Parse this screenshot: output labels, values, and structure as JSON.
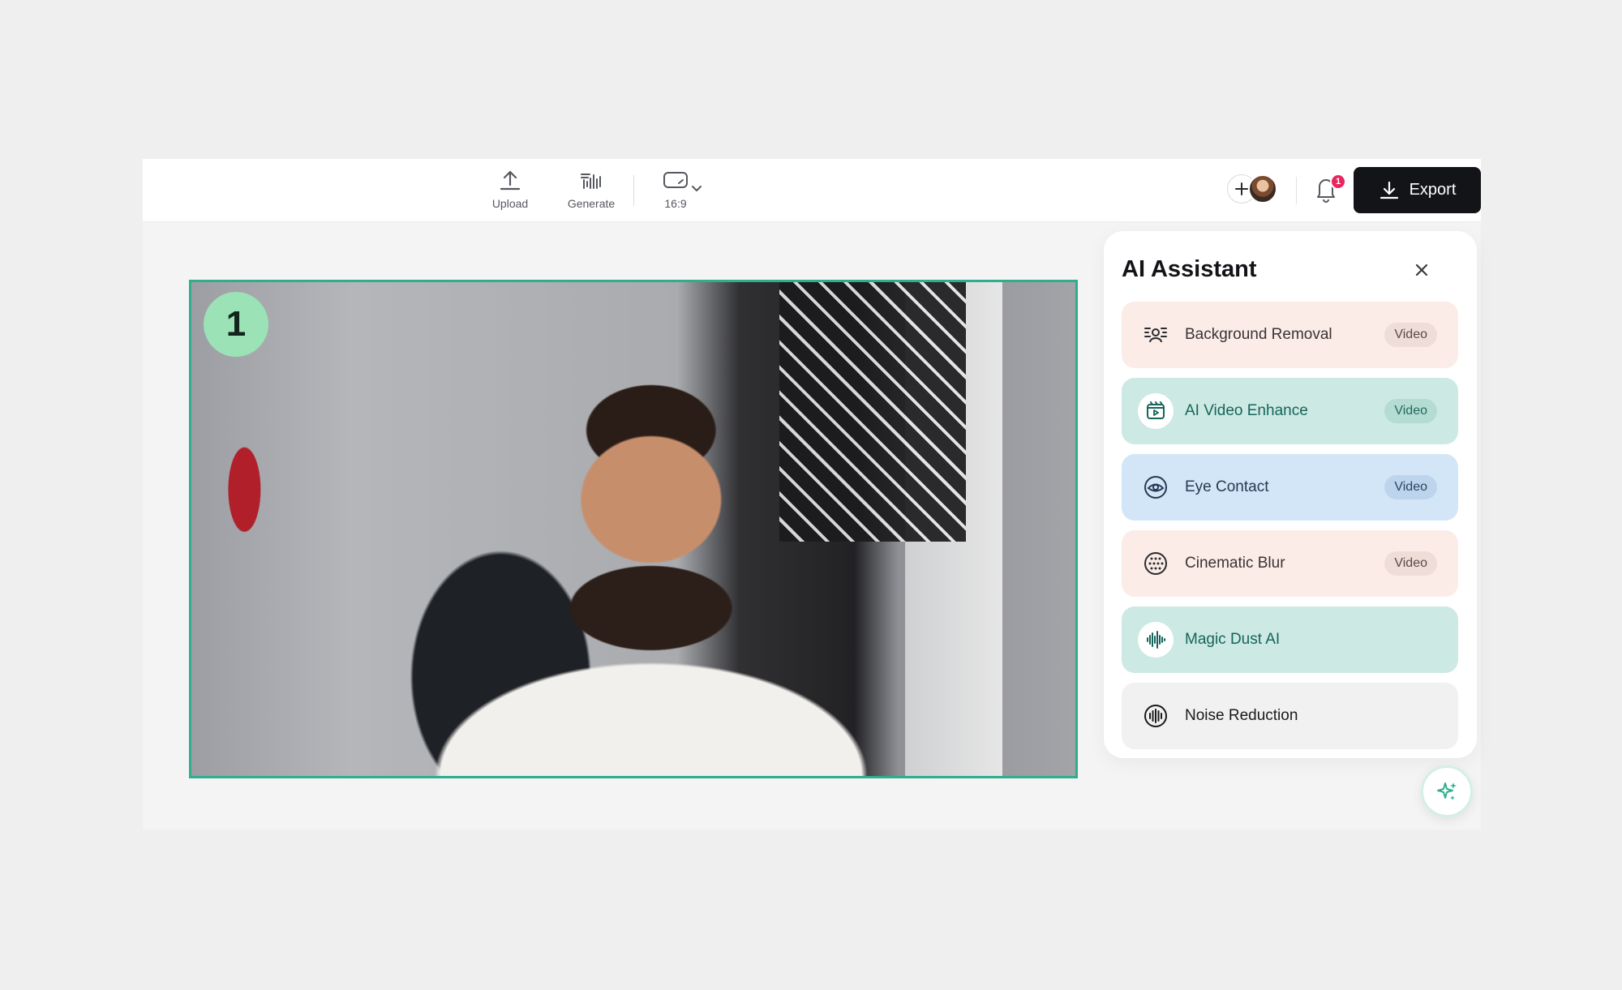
{
  "toolbar": {
    "upload_label": "Upload",
    "generate_label": "Generate",
    "aspect_ratio": "16:9",
    "export_label": "Export",
    "notification_count": "1"
  },
  "canvas": {
    "scene_number": "1"
  },
  "ai_assistant": {
    "title": "AI Assistant",
    "items": [
      {
        "label": "Background Removal",
        "tag": "Video",
        "icon": "background-removal-icon"
      },
      {
        "label": "AI Video Enhance",
        "tag": "Video",
        "icon": "video-enhance-icon"
      },
      {
        "label": "Eye Contact",
        "tag": "Video",
        "icon": "eye-contact-icon"
      },
      {
        "label": "Cinematic Blur",
        "tag": "Video",
        "icon": "cinematic-blur-icon"
      },
      {
        "label": "Magic Dust AI",
        "icon": "audio-wave-icon"
      },
      {
        "label": "Noise Reduction",
        "icon": "noise-reduction-icon"
      }
    ]
  },
  "colors": {
    "accent": "#2fae8c",
    "export_bg": "#121417",
    "badge": "#e8265e",
    "scene_badge": "#9be2b6"
  }
}
